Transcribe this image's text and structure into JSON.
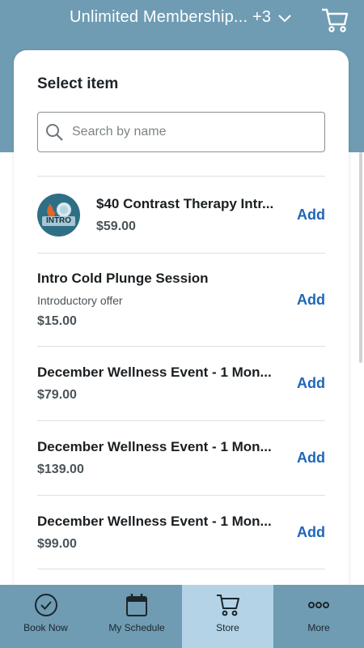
{
  "header": {
    "membership_title": "Unlimited Membership... +3"
  },
  "card": {
    "title": "Select item"
  },
  "search": {
    "placeholder": "Search by name"
  },
  "items": [
    {
      "name": "$40 Contrast Therapy Intr...",
      "subtitle": "",
      "price": "$59.00",
      "add_label": "Add",
      "thumb_text": "INTRO"
    },
    {
      "name": "Intro Cold Plunge Session",
      "subtitle": "Introductory offer",
      "price": "$15.00",
      "add_label": "Add"
    },
    {
      "name": "December Wellness Event - 1 Mon...",
      "subtitle": "",
      "price": "$79.00",
      "add_label": "Add"
    },
    {
      "name": "December Wellness Event - 1 Mon...",
      "subtitle": "",
      "price": "$139.00",
      "add_label": "Add"
    },
    {
      "name": "December Wellness Event - 1 Mon...",
      "subtitle": "",
      "price": "$99.00",
      "add_label": "Add"
    }
  ],
  "tabs": [
    {
      "label": "Book Now",
      "icon": "check-circle-icon"
    },
    {
      "label": "My Schedule",
      "icon": "calendar-icon"
    },
    {
      "label": "Store",
      "icon": "cart-icon",
      "active": true
    },
    {
      "label": "More",
      "icon": "more-dots-icon"
    }
  ],
  "colors": {
    "brand": "#6f9cb3",
    "active_tab": "#b4d3e6",
    "link": "#1f66b8"
  }
}
